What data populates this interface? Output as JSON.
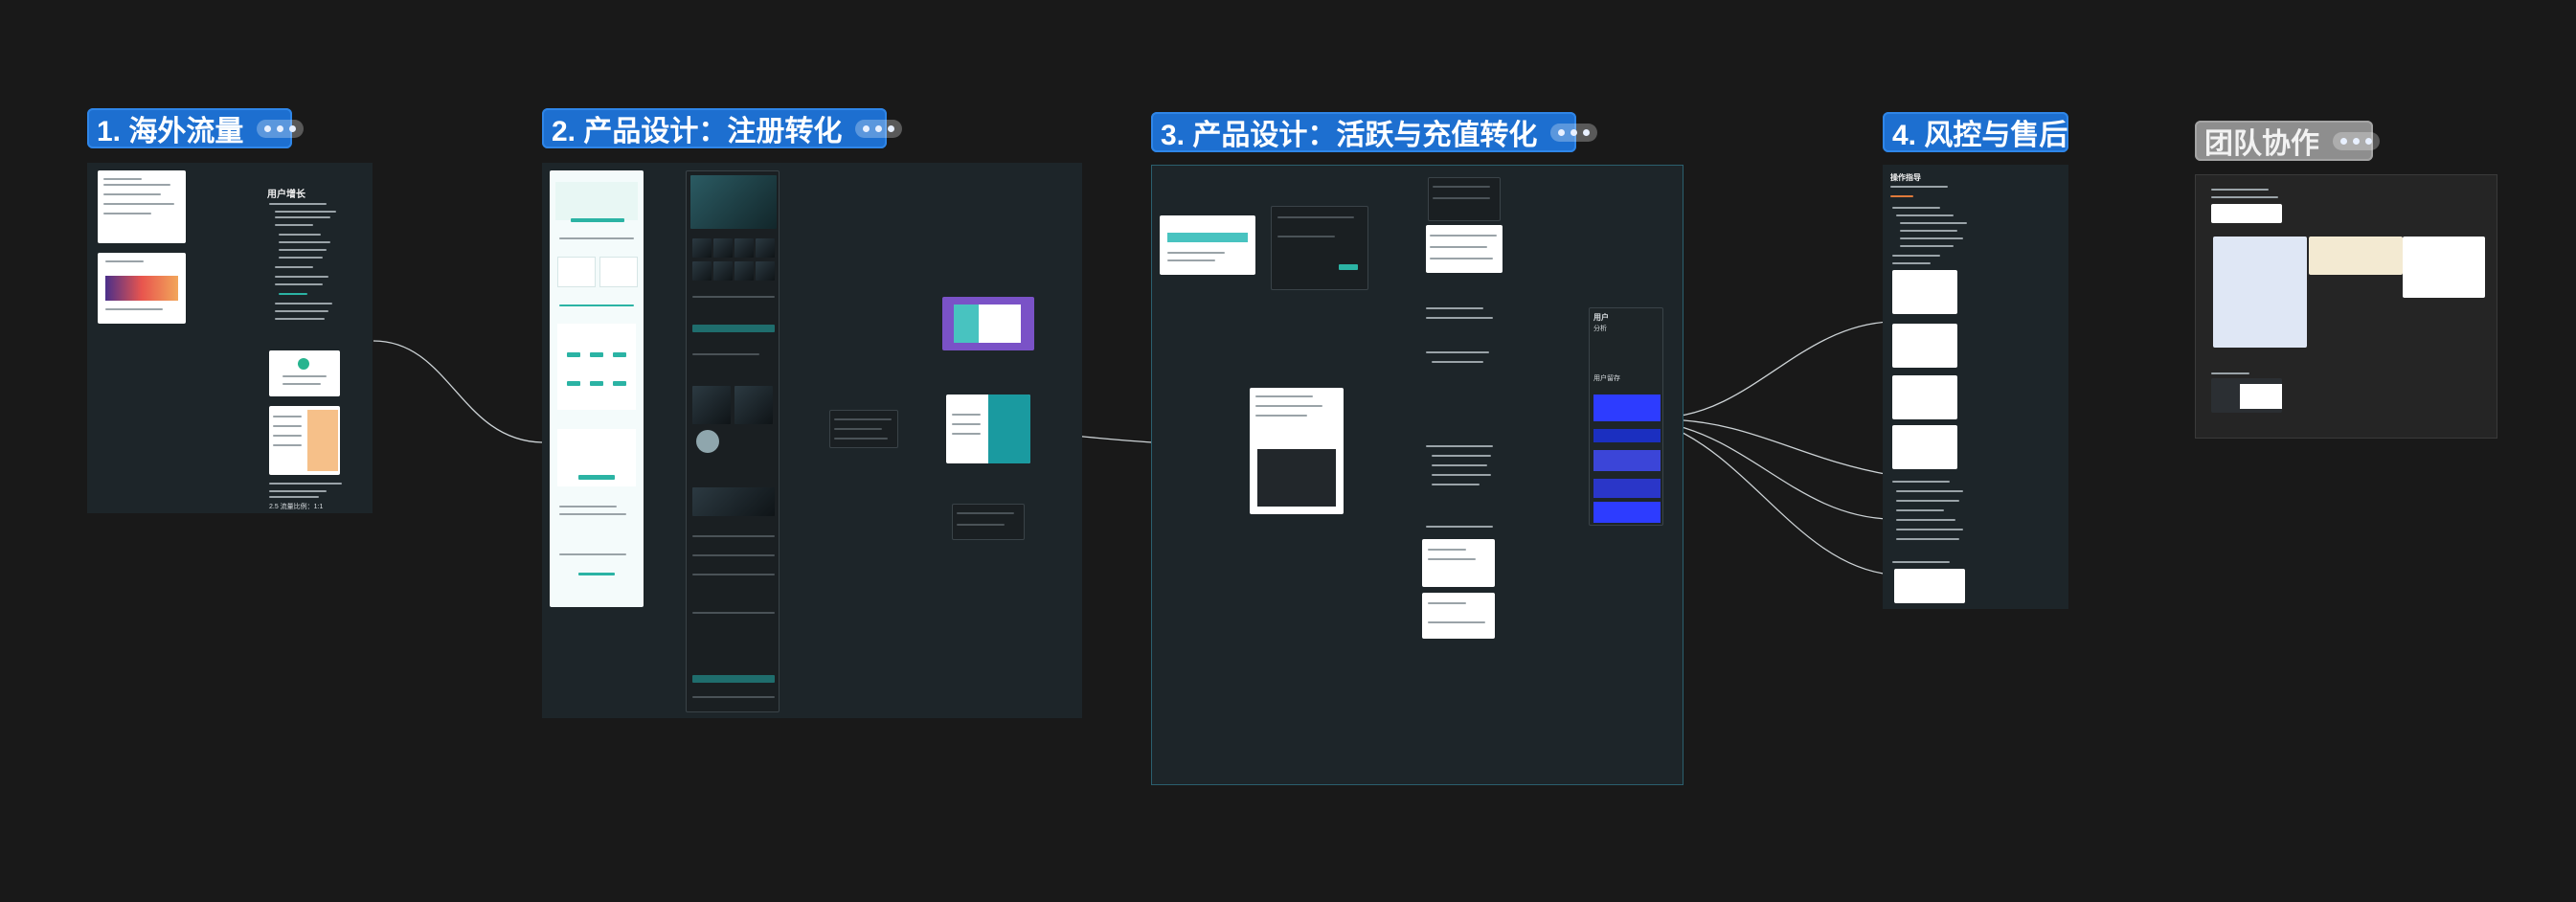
{
  "sections": [
    {
      "id": "s1",
      "title": "1. 海外流量"
    },
    {
      "id": "s2",
      "title": "2. 产品设计：注册转化"
    },
    {
      "id": "s3",
      "title": "3. 产品设计：活跃与充值转化"
    },
    {
      "id": "s4",
      "title": "4. 风控与售后"
    },
    {
      "id": "s5",
      "title": "团队协作"
    }
  ],
  "s1": {
    "note_title": "用户增长",
    "bottom_note": "2.5 流量比例：1:1"
  },
  "s3": {
    "right_title": "用户",
    "right_sub1": "分析",
    "right_sub2": "用户留存"
  },
  "s4": {
    "note_title": "操作指导"
  },
  "colors": {
    "section_blue": "#1d6fd0",
    "section_gray": "#8e8e8e",
    "canvas_bg": "#191919",
    "frame_bg": "#1d2529",
    "accent_teal": "#1a9aa0",
    "accent_purple": "#7a52c7",
    "chart_blue": "#2d3cff"
  },
  "icons": [
    "more-dots-icon"
  ]
}
